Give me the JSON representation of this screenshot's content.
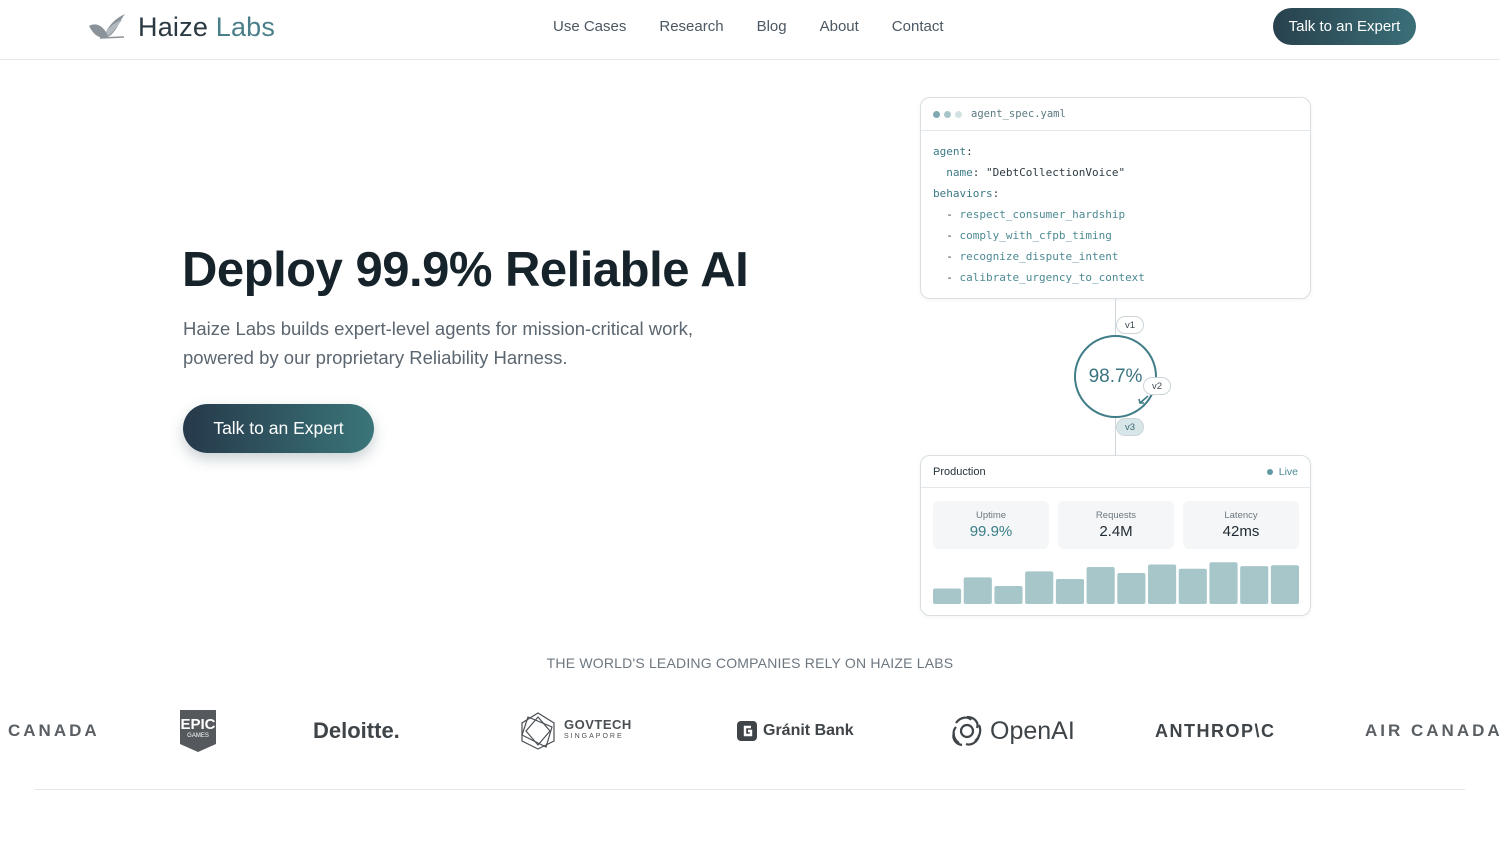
{
  "nav": {
    "brand_name": "Haize",
    "brand_suffix": "Labs",
    "links": [
      "Use Cases",
      "Research",
      "Blog",
      "About",
      "Contact"
    ],
    "cta_label": "Talk to an Expert"
  },
  "hero": {
    "title": "Deploy 99.9% Reliable AI",
    "subtitle": "Haize Labs builds expert-level agents for mission-critical work, powered by our proprietary Reliability Harness.",
    "cta_label": "Talk to an Expert"
  },
  "spec_card": {
    "filename": "agent_spec.yaml",
    "agent_key": "agent",
    "name_key": "name",
    "name_value": "\"DebtCollectionVoice\"",
    "behaviors_key": "behaviors",
    "behaviors": [
      "respect_consumer_hardship",
      "comply_with_cfpb_timing",
      "recognize_dispute_intent",
      "calibrate_urgency_to_context"
    ]
  },
  "versions": {
    "score": "98.7%",
    "v1": "v1",
    "v2": "v2",
    "v3": "v3"
  },
  "production": {
    "title": "Production",
    "status": "Live",
    "metrics": [
      {
        "label": "Uptime",
        "value": "99.9%"
      },
      {
        "label": "Requests",
        "value": "2.4M"
      },
      {
        "label": "Latency",
        "value": "42ms"
      }
    ],
    "bar_levels": [
      0.36,
      0.62,
      0.42,
      0.76,
      0.58,
      0.86,
      0.72,
      0.92,
      0.82,
      0.97,
      0.88,
      0.9
    ],
    "bar_color": "#a6c6c9"
  },
  "logos": {
    "tagline": "THE WORLD'S LEADING COMPANIES RELY ON HAIZE LABS",
    "items": [
      {
        "name": "CANADA",
        "icon": ""
      },
      {
        "name": "EPIC",
        "sub": "GAMES",
        "icon": "epic-shield-icon"
      },
      {
        "name": "Deloitte.",
        "icon": ""
      },
      {
        "name": "GOVTECH",
        "sub": "SINGAPORE",
        "icon": "govtech-icon"
      },
      {
        "name": "Gránit Bank",
        "icon": "granit-g-icon"
      },
      {
        "name": "OpenAI",
        "icon": "openai-knot-icon"
      },
      {
        "name": "ANTHROP\\C",
        "icon": ""
      },
      {
        "name": "AIR CANADA",
        "icon": "maple-leaf-icon"
      }
    ]
  },
  "colors": {
    "accent": "#3f7d87",
    "cta_dark": "#27414d"
  }
}
